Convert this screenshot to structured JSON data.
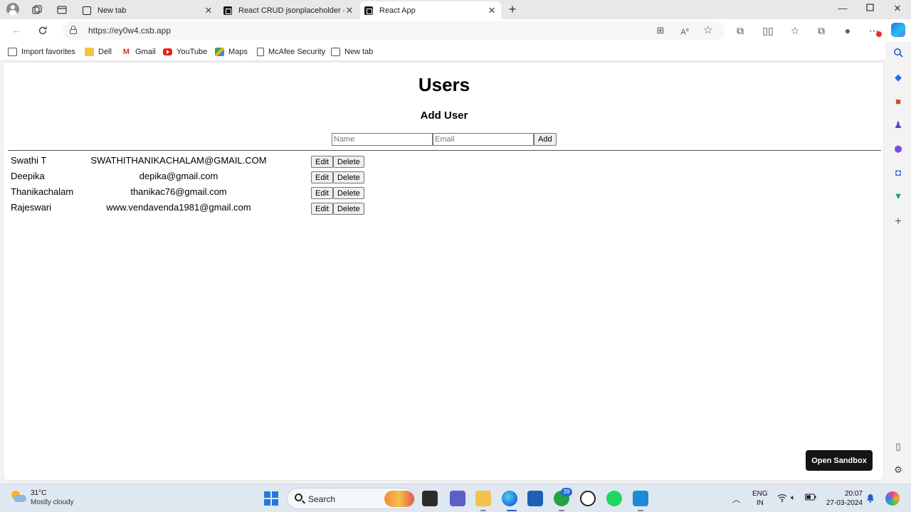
{
  "browser": {
    "tabs": [
      {
        "title": "New tab",
        "favicon": "newtab-icon",
        "active": false
      },
      {
        "title": "React CRUD jsonplaceholder - Co",
        "favicon": "codesandbox-icon",
        "active": false
      },
      {
        "title": "React App",
        "favicon": "codesandbox-icon",
        "active": true
      }
    ],
    "url": "https://ey0w4.csb.app",
    "favorites": [
      {
        "label": "Import favorites",
        "icon": "import-icon"
      },
      {
        "label": "Dell",
        "icon": "folder-icon"
      },
      {
        "label": "Gmail",
        "icon": "gmail-icon"
      },
      {
        "label": "YouTube",
        "icon": "youtube-icon"
      },
      {
        "label": "Maps",
        "icon": "maps-icon"
      },
      {
        "label": "McAfee Security",
        "icon": "document-icon"
      },
      {
        "label": "New tab",
        "icon": "newtab-icon"
      }
    ]
  },
  "app": {
    "title": "Users",
    "subtitle": "Add User",
    "form": {
      "name_placeholder": "Name",
      "email_placeholder": "Email",
      "add_label": "Add"
    },
    "users": [
      {
        "name": "Swathi T",
        "email": "SWATHITHANIKACHALAM@GMAIL.COM"
      },
      {
        "name": "Deepika",
        "email": "depika@gmail.com"
      },
      {
        "name": "Thanikachalam",
        "email": "thanikac76@gmail.com"
      },
      {
        "name": "Rajeswari",
        "email": "www.vendavenda1981@gmail.com"
      }
    ],
    "edit_label": "Edit",
    "delete_label": "Delete",
    "open_sandbox_label": "Open Sandbox"
  },
  "taskbar": {
    "weather_temp": "31°C",
    "weather_condition": "Mostly cloudy",
    "search_label": "Search",
    "whatsapp_badge": "39",
    "lang_line1": "ENG",
    "lang_line2": "IN",
    "time": "20:07",
    "date": "27-03-2024"
  },
  "colors": {
    "accent": "#1f7ae0",
    "sandbox_button": "#151515"
  }
}
